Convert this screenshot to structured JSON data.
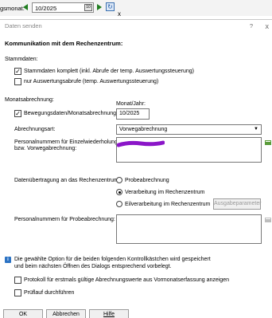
{
  "topbar": {
    "month_label": "gsmonat:",
    "month_value": "10/2025",
    "calendar_text": "10",
    "close_tab": "x"
  },
  "dialog": {
    "title": "Daten senden",
    "help": "?",
    "close": "x",
    "heading": "Kommunikation mit dem Rechenzentrum:",
    "stammdaten": {
      "label": "Stammdaten:",
      "opt1": "Stammdaten komplett (inkl. Abrufe der temp. Auswertungssteuerung)",
      "opt1_checked": true,
      "opt2": "nur Auswertungsabrufe (temp. Auswertungssteuerung)",
      "opt2_checked": false
    },
    "monatsabrechnung": {
      "label": "Monatsabrechnung:",
      "opt": "Bewegungsdaten/Monatsabrechnung",
      "opt_checked": true,
      "monat_label": "Monat/Jahr:",
      "monat_value": "10/2025"
    },
    "abrechnungsart": {
      "label": "Abrechnungsart:",
      "value": "Vorwegabrechnung"
    },
    "personal_einzel": {
      "label_line1": "Personalnummern für Einzelwiederholung",
      "label_line2": "bzw. Vorwegabrechnung:"
    },
    "datenuebertragung": {
      "label": "Datenübertragung an das Rechenzentrum:",
      "options": [
        "Probeabrechnung",
        "Verarbeitung im Rechenzentrum",
        "Eilverarbeitung im Rechenzentrum"
      ],
      "selected": 1,
      "ausgabe_button": "Ausgabeparameter"
    },
    "probe": {
      "label": "Personalnummern für Probeabrechnung:"
    },
    "info": {
      "line1": "Die gewählte Option für die beiden folgenden Kontrollkästchen wird gespeichert",
      "line2": "und beim nächsten Öffnen des Dialogs entsprechend vorbelegt."
    },
    "protokoll": "Protokoll für erstmals gültige Abrechnungswerte aus Vormonatserfassung anzeigen",
    "pruflauf": "Prüflauf durchführen",
    "buttons": {
      "ok": "OK",
      "abbrechen": "Abbrechen",
      "hilfe": "Hilfe"
    }
  },
  "colors": {
    "redaction": "#8b16c8",
    "accent": "#1f7d1f",
    "info": "#2c73c4"
  }
}
